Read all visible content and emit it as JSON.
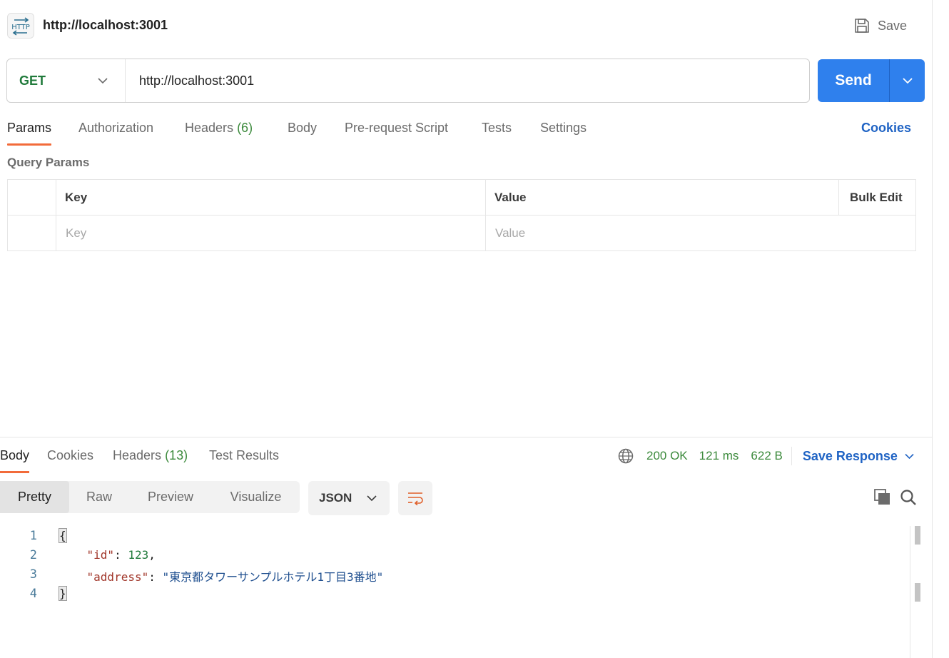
{
  "request": {
    "title": "http://localhost:3001",
    "badge_icon": "http-icon",
    "save_label": "Save",
    "method": "GET",
    "url": "http://localhost:3001",
    "send_label": "Send"
  },
  "request_tabs": {
    "params": "Params",
    "authorization": "Authorization",
    "headers": "Headers",
    "headers_count": "(6)",
    "body": "Body",
    "pre_request": "Pre-request Script",
    "tests": "Tests",
    "settings": "Settings",
    "cookies": "Cookies"
  },
  "query_params": {
    "label": "Query Params",
    "col_key": "Key",
    "col_value": "Value",
    "bulk_edit": "Bulk Edit",
    "key_placeholder": "Key",
    "value_placeholder": "Value"
  },
  "response": {
    "tabs": {
      "body": "Body",
      "cookies": "Cookies",
      "headers": "Headers",
      "headers_count": "(13)",
      "test_results": "Test Results"
    },
    "status": "200 OK",
    "time": "121 ms",
    "size": "622 B",
    "save_response": "Save Response",
    "formats": {
      "pretty": "Pretty",
      "raw": "Raw",
      "preview": "Preview",
      "visualize": "Visualize"
    },
    "language": "JSON",
    "code": {
      "line_numbers": [
        "1",
        "2",
        "3",
        "4"
      ],
      "open_brace": "{",
      "close_brace": "}",
      "id_key": "\"id\"",
      "id_value": "123",
      "address_key": "\"address\"",
      "address_value": "\"東京都タワーサンプルホテル1丁目3番地\""
    }
  },
  "colors": {
    "accent": "#2f80ed",
    "method_green": "#207a3b",
    "tab_indicator": "#f26b3a",
    "link_blue": "#1f63c4"
  }
}
